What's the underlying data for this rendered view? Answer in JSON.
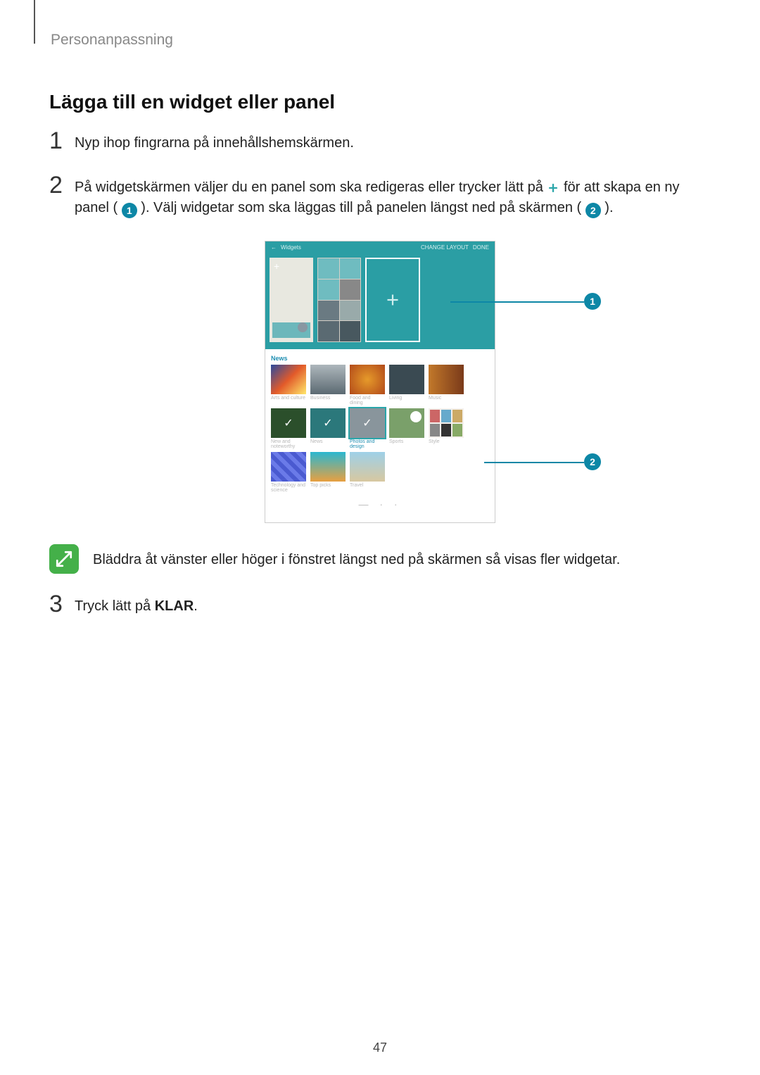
{
  "breadcrumb": "Personanpassning",
  "heading": "Lägga till en widget eller panel",
  "steps": {
    "s1": {
      "num": "1",
      "text": "Nyp ihop fingrarna på innehållshemskärmen."
    },
    "s2": {
      "num": "2",
      "part1": "På widgetskärmen väljer du en panel som ska redigeras eller trycker lätt på ",
      "part2": " för att skapa en ny panel (",
      "part3": "). Välj widgetar som ska läggas till på panelen längst ned på skärmen (",
      "part4": ")."
    },
    "s3": {
      "num": "3",
      "pre": "Tryck lätt på ",
      "klar": "KLAR",
      "post": "."
    }
  },
  "callouts": {
    "one": "1",
    "two": "2"
  },
  "note_text": "Bläddra åt vänster eller höger i fönstret längst ned på skärmen så visas fler widgetar.",
  "page_number": "47",
  "tablet": {
    "back": "←",
    "title": "Widgets",
    "change_layout": "CHANGE LAYOUT",
    "done": "DONE",
    "section_news": "News",
    "row1": [
      "Arts and culture",
      "Business",
      "Food and dining",
      "Living",
      "Music"
    ],
    "row2": [
      "New and noteworthy",
      "News",
      "Photos and design",
      "Sports",
      "Style"
    ],
    "row3": [
      "Technology and science",
      "Top picks",
      "Travel"
    ]
  }
}
